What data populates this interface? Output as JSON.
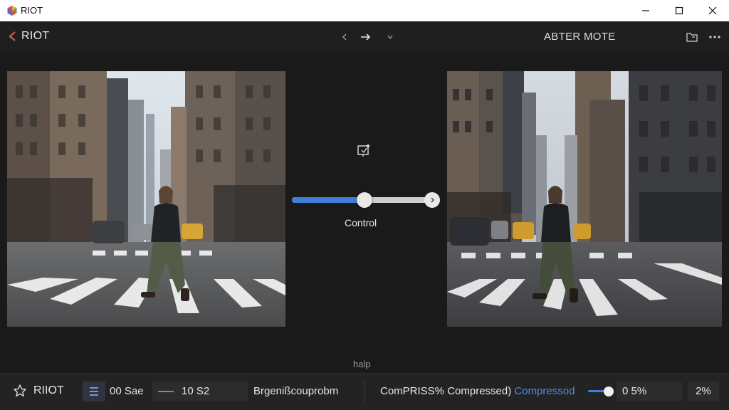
{
  "window": {
    "title": "RIOT"
  },
  "header": {
    "app_name": "RIOT",
    "mode": "ABTER MOTE",
    "icons": {
      "logo": "riot-logo-icon",
      "back": "chevron-left-icon",
      "forward": "arrow-right-icon",
      "down": "chevron-down-icon",
      "folder": "folder-icon",
      "more": "more-icon"
    }
  },
  "main": {
    "control_label": "Control",
    "help_label": "halp",
    "slider_value": 0.49
  },
  "bottom_bar": {
    "name": "RIIOT",
    "size": "00 Sae",
    "value": "10 S2",
    "format": "Brgenißcouprobm",
    "status_text": "ComPRISS% Compressed)",
    "status_link": "Compressod",
    "quality_value": 0.7,
    "percent": "0 5%",
    "zoom": "2%"
  },
  "colors": {
    "accent": "#3f7fd8",
    "link": "#4a90e2",
    "background": "#1a1a1a"
  }
}
